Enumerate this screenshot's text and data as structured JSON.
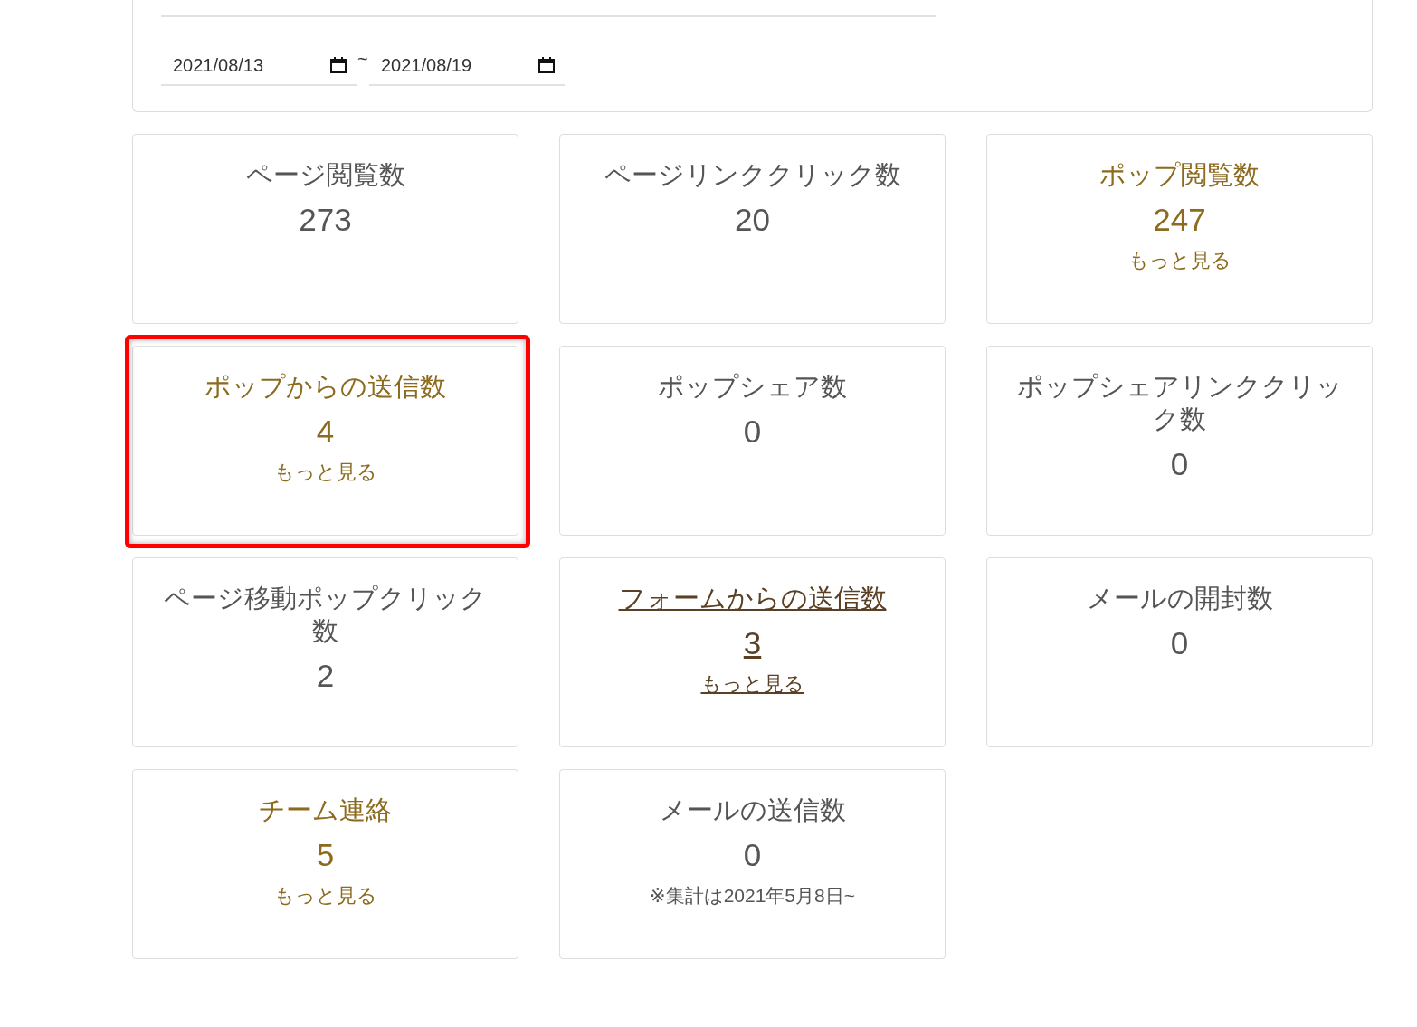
{
  "date_range": {
    "start": "2021/08/13",
    "separator": "~",
    "end": "2021/08/19"
  },
  "cards": [
    {
      "kind": "plain",
      "title": "ページ閲覧数",
      "value": "273",
      "hovered": false,
      "highlighted": false
    },
    {
      "kind": "plain",
      "title": "ページリンククリック数",
      "value": "20",
      "hovered": false,
      "highlighted": false
    },
    {
      "kind": "link",
      "title": "ポップ閲覧数",
      "value": "247",
      "more": "もっと見る",
      "hovered": false,
      "highlighted": false
    },
    {
      "kind": "link",
      "title": "ポップからの送信数",
      "value": "4",
      "more": "もっと見る",
      "hovered": false,
      "highlighted": true
    },
    {
      "kind": "plain",
      "title": "ポップシェア数",
      "value": "0",
      "hovered": false,
      "highlighted": false
    },
    {
      "kind": "plain",
      "title": "ポップシェアリンククリック数",
      "value": "0",
      "hovered": false,
      "highlighted": false
    },
    {
      "kind": "plain",
      "title": "ページ移動ポップクリック数",
      "value": "2",
      "hovered": false,
      "highlighted": false
    },
    {
      "kind": "link",
      "title": "フォームからの送信数",
      "value": "3",
      "more": "もっと見る",
      "hovered": true,
      "highlighted": false
    },
    {
      "kind": "plain",
      "title": "メールの開封数",
      "value": "0",
      "hovered": false,
      "highlighted": false
    },
    {
      "kind": "link",
      "title": "チーム連絡",
      "value": "5",
      "more": "もっと見る",
      "hovered": false,
      "highlighted": false
    },
    {
      "kind": "plain",
      "title": "メールの送信数",
      "value": "0",
      "note": "※集計は2021年5月8日~",
      "hovered": false,
      "highlighted": false
    }
  ]
}
